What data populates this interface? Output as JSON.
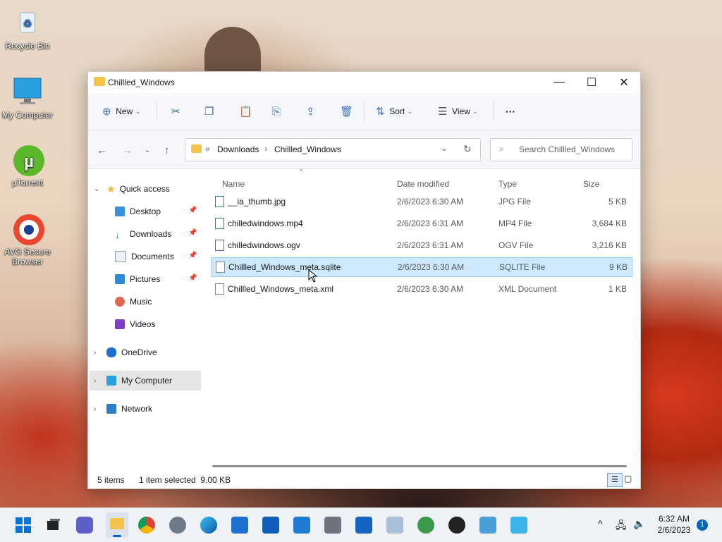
{
  "desktop": {
    "icons": [
      {
        "label": "Recycle Bin",
        "icon": "recycle-bin-icon"
      },
      {
        "label": "My Computer",
        "icon": "monitor-icon"
      },
      {
        "label": "µTorrent",
        "icon": "utorrent-icon"
      },
      {
        "label": "AVG Secure Browser",
        "icon": "avg-browser-icon"
      }
    ]
  },
  "window": {
    "title": "Chillled_Windows",
    "controls": {
      "minimize": "—",
      "maximize": "☐",
      "close": "✕"
    },
    "toolbar": {
      "new_label": "New",
      "sort_label": "Sort",
      "view_label": "View",
      "more_label": "···"
    },
    "address": {
      "prefix": "«",
      "crumbs": [
        "Downloads",
        "Chillled_Windows"
      ]
    },
    "search": {
      "placeholder": "Search Chillled_Windows"
    },
    "nav": {
      "quick_access": "Quick access",
      "pinned": [
        "Desktop",
        "Downloads",
        "Documents",
        "Pictures"
      ],
      "unpinned": [
        "Music",
        "Videos"
      ],
      "onedrive": "OneDrive",
      "my_computer": "My Computer",
      "network": "Network"
    },
    "columns": {
      "name": "Name",
      "date": "Date modified",
      "type": "Type",
      "size": "Size"
    },
    "files": [
      {
        "name": "__ia_thumb.jpg",
        "date": "2/6/2023 6:30 AM",
        "type": "JPG File",
        "size": "5 KB"
      },
      {
        "name": "chilledwindows.mp4",
        "date": "2/6/2023 6:31 AM",
        "type": "MP4 File",
        "size": "3,684 KB"
      },
      {
        "name": "chilledwindows.ogv",
        "date": "2/6/2023 6:31 AM",
        "type": "OGV File",
        "size": "3,216 KB"
      },
      {
        "name": "Chillled_Windows_meta.sqlite",
        "date": "2/6/2023 6:30 AM",
        "type": "SQLITE File",
        "size": "9 KB"
      },
      {
        "name": "Chillled_Windows_meta.xml",
        "date": "2/6/2023 6:30 AM",
        "type": "XML Document",
        "size": "1 KB"
      }
    ],
    "status": {
      "items": "5 items",
      "selected": "1 item selected  9.00 KB"
    }
  },
  "taskbar": {
    "time": "6:32 AM",
    "date": "2/6/2023",
    "notifications": "1",
    "tray_chevron": "^"
  },
  "colors": {
    "accent": "#0067c0",
    "selection": "#cde8ff"
  }
}
